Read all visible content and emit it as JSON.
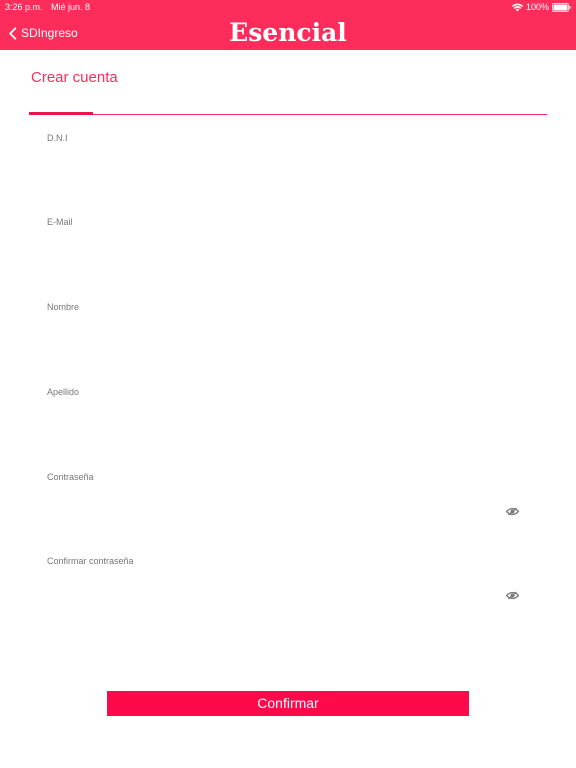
{
  "status_bar": {
    "time": "3:26 p.m.",
    "date": "Mié jun. 8",
    "battery": "100%"
  },
  "nav": {
    "back_label": "SDIngreso",
    "title": "Esencial"
  },
  "page": {
    "title": "Crear cuenta"
  },
  "form": {
    "fields": [
      {
        "label": "D.N.I",
        "value": ""
      },
      {
        "label": "E-Mail",
        "value": ""
      },
      {
        "label": "Nombre",
        "value": ""
      },
      {
        "label": "Apellido",
        "value": ""
      },
      {
        "label": "Contraseña",
        "value": ""
      },
      {
        "label": "Confirmar contraseña",
        "value": ""
      }
    ],
    "confirm_label": "Confirmar"
  },
  "icons": {
    "back": "chevron-left-icon",
    "password_toggle": "eye-slash-icon",
    "wifi": "wifi-icon",
    "battery": "battery-icon"
  },
  "colors": {
    "header": "#fe2c5a",
    "accent": "#fe2c5a",
    "button": "#fe0a4b",
    "label": "#777777"
  }
}
